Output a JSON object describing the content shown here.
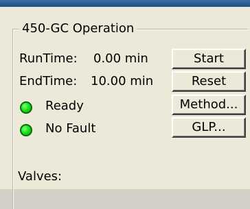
{
  "group": {
    "title": "450-GC Operation"
  },
  "runtime": {
    "label": "RunTime:",
    "value": "0.00 min"
  },
  "endtime": {
    "label": "EndTime:",
    "value": "10.00 min"
  },
  "status": [
    {
      "label": "Ready",
      "color": "#1ee31e"
    },
    {
      "label": "No Fault",
      "color": "#1ee31e"
    }
  ],
  "buttons": {
    "start": "Start",
    "reset": "Reset",
    "method": "Method...",
    "glp": "GLP..."
  },
  "valves": {
    "label": "Valves:"
  }
}
